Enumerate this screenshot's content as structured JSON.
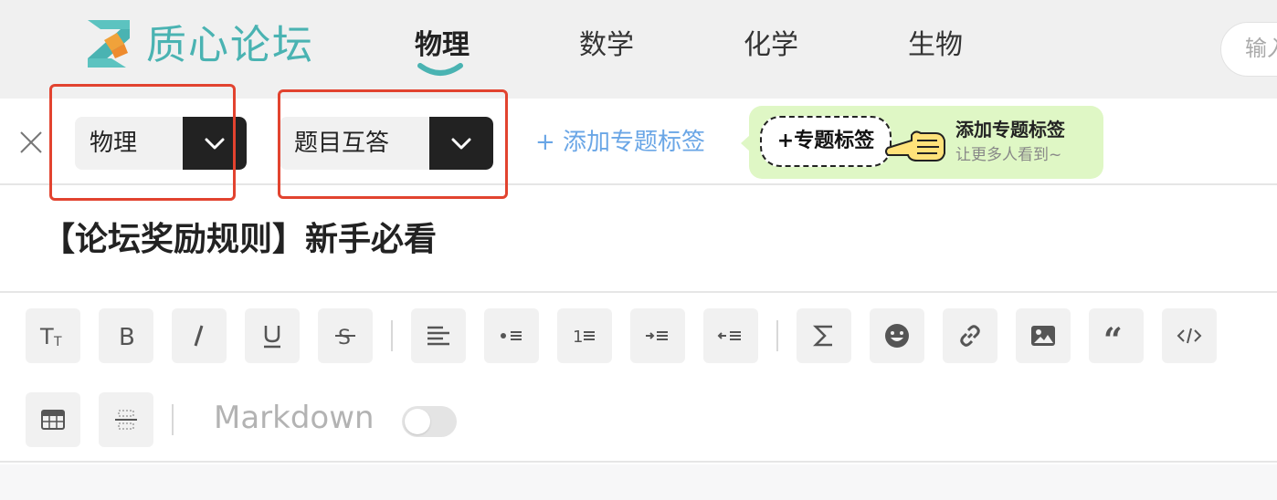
{
  "header": {
    "site_title": "质心论坛",
    "nav": [
      "物理",
      "数学",
      "化学",
      "生物"
    ],
    "active_nav": "物理",
    "search_placeholder": "输入",
    "brand_color": "#4ab3b2"
  },
  "tag_row": {
    "subject_select": "物理",
    "type_select": "题目互答",
    "add_topic_label": "+ 添加专题标签",
    "hint": {
      "tag_label": "+专题标签",
      "title": "添加专题标签",
      "subtitle": "让更多人看到~"
    },
    "highlight_color": "#e2432f"
  },
  "post": {
    "title": "【论坛奖励规则】新手必看"
  },
  "toolbar": {
    "buttons_row1": [
      "text-size-icon",
      "bold-icon",
      "italic-icon",
      "underline-icon",
      "strikethrough-icon",
      "align-left-icon",
      "bullet-list-icon",
      "numbered-list-icon",
      "indent-icon",
      "outdent-icon",
      "formula-icon",
      "emoji-icon",
      "link-icon",
      "image-icon",
      "quote-icon",
      "code-icon"
    ],
    "buttons_row2": [
      "table-icon",
      "divider-icon"
    ],
    "markdown_label": "Markdown",
    "markdown_enabled": false
  }
}
